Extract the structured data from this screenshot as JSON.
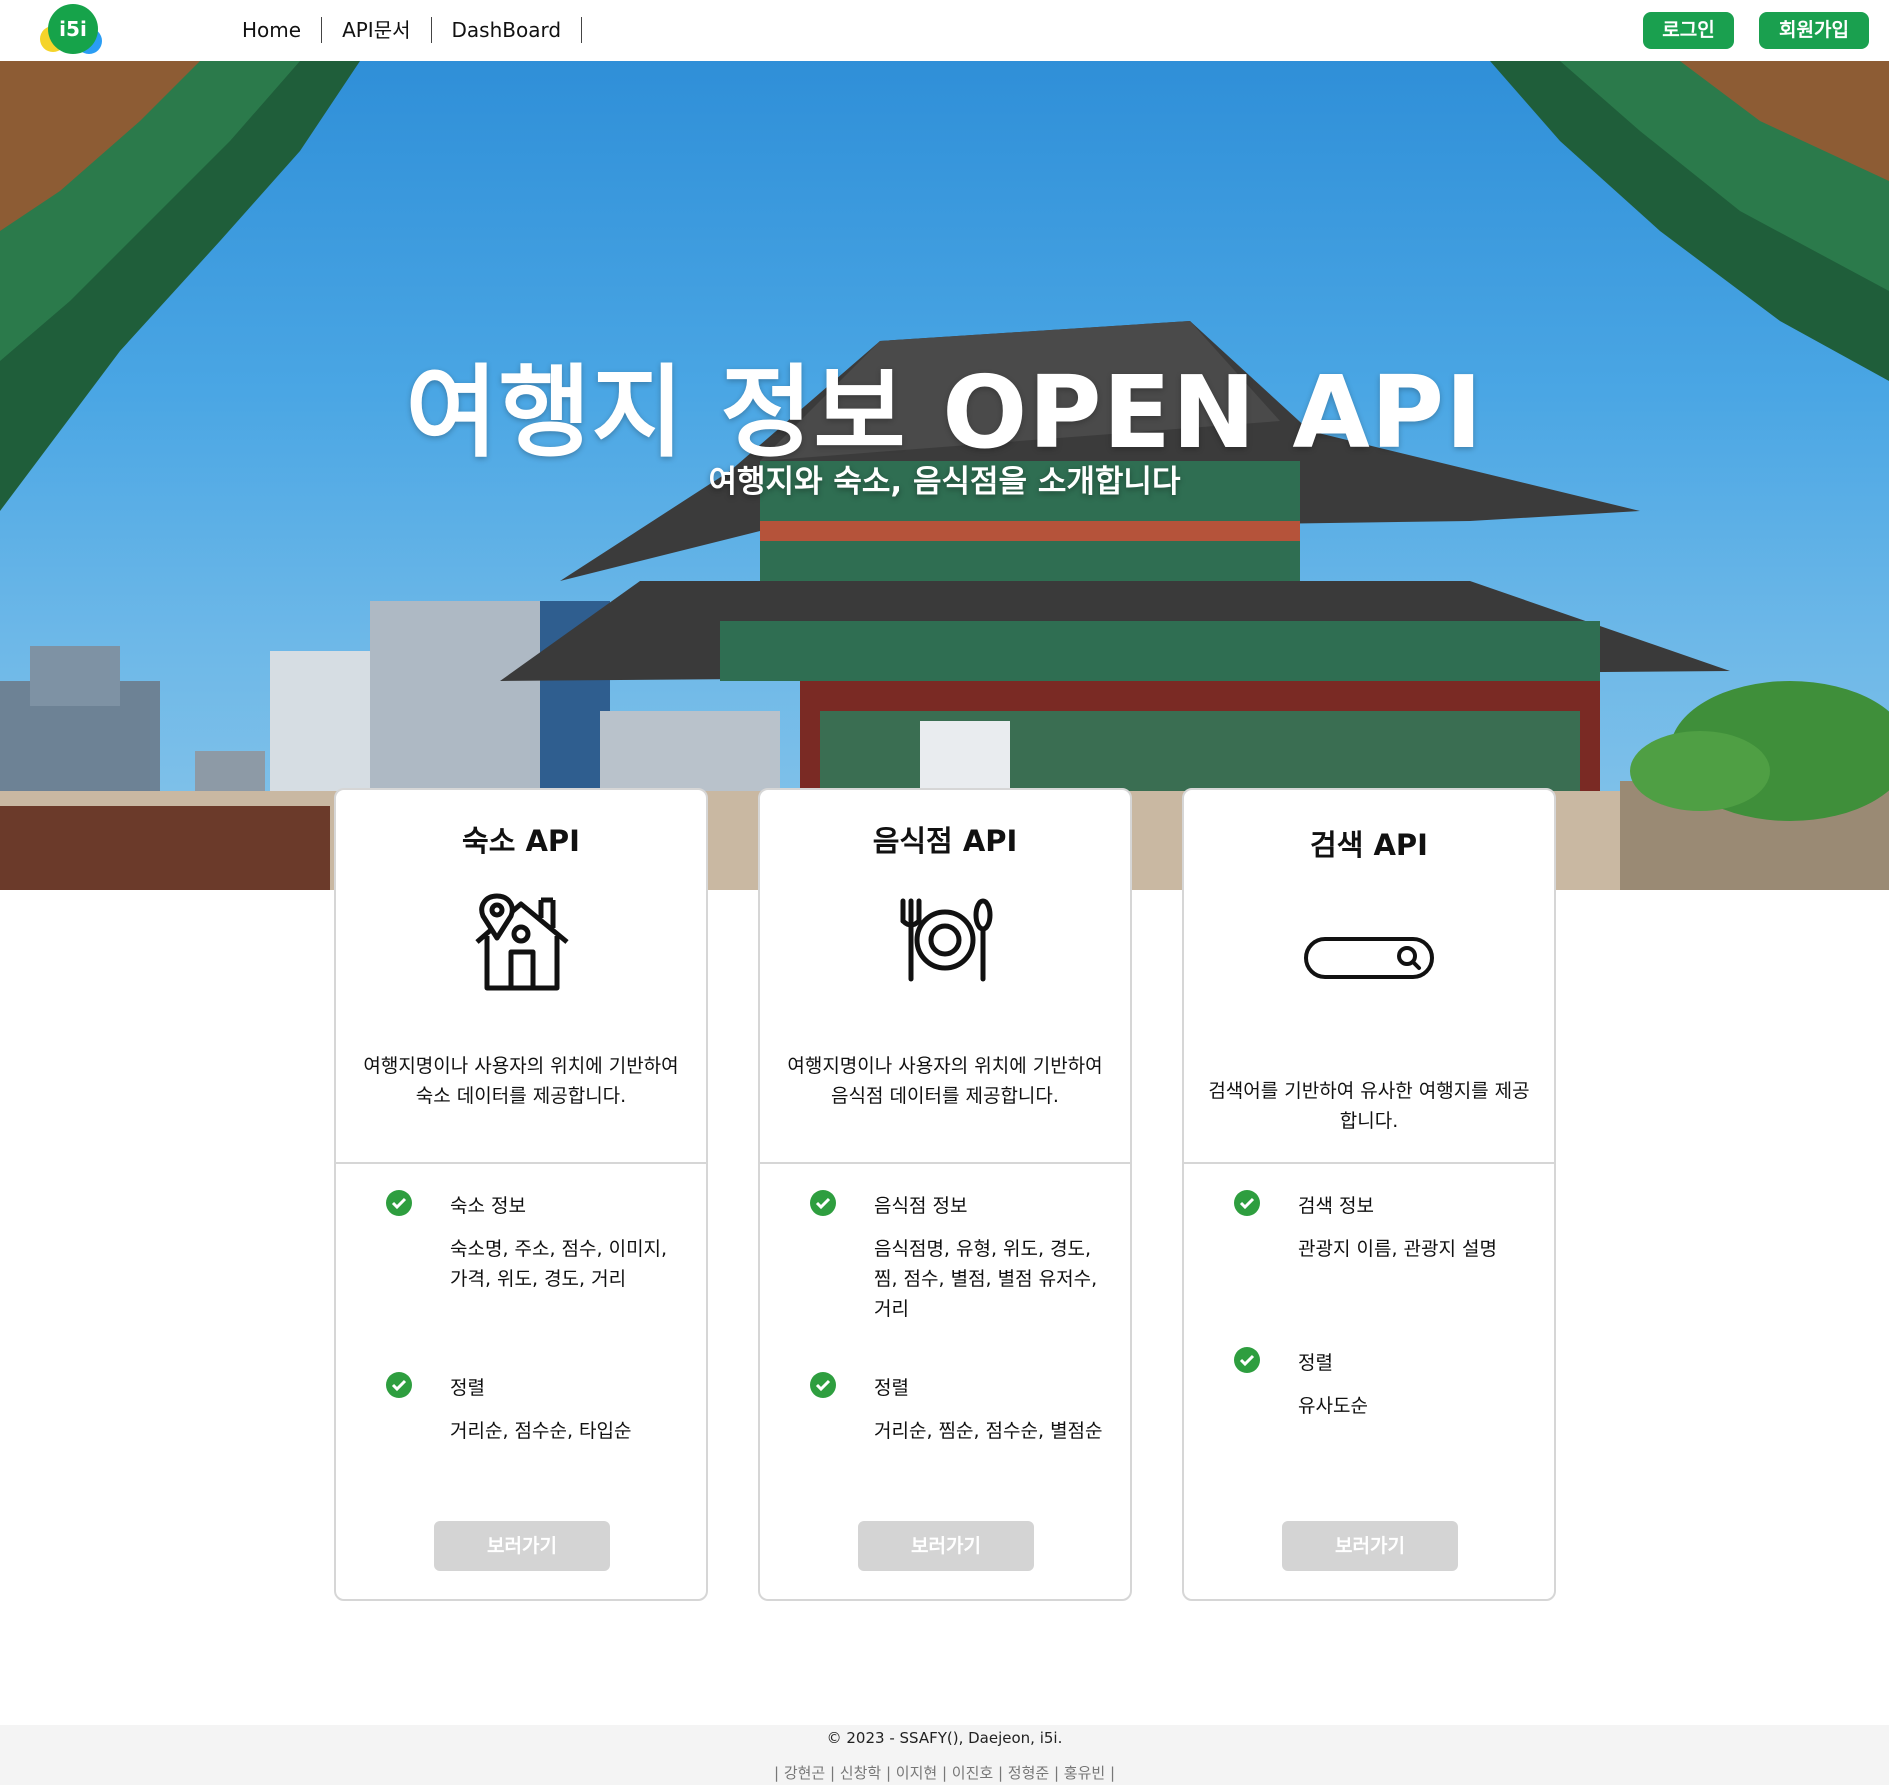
{
  "nav": {
    "logo_text": "i5i",
    "links": [
      "Home",
      "API문서",
      "DashBoard"
    ],
    "login": "로그인",
    "signup": "회원가입"
  },
  "hero": {
    "title": "여행지 정보 OPEN API",
    "subtitle": "여행지와 숙소, 음식점을 소개합니다"
  },
  "cards": [
    {
      "title": "숙소 API",
      "icon": "house-location-icon",
      "description": "여행지명이나 사용자의 위치에 기반하여 숙소 데이터를 제공합니다.",
      "features": [
        {
          "title": "숙소 정보",
          "body": "숙소명, 주소, 점수, 이미지, 가격, 위도, 경도, 거리"
        },
        {
          "title": "정렬",
          "body": "거리순, 점수순, 타입순"
        }
      ],
      "button": "보러가기"
    },
    {
      "title": "음식점 API",
      "icon": "plate-fork-spoon-icon",
      "description": "여행지명이나 사용자의 위치에 기반하여 음식점 데이터를 제공합니다.",
      "features": [
        {
          "title": "음식점 정보",
          "body": "음식점명, 유형, 위도, 경도, 찜, 점수, 별점, 별점 유저수, 거리"
        },
        {
          "title": "정렬",
          "body": "거리순, 찜순, 점수순, 별점순"
        }
      ],
      "button": "보러가기"
    },
    {
      "title": "검색 API",
      "icon": "search-bar-icon",
      "description": "검색어를 기반하여 유사한 여행지를 제공합니다.",
      "features": [
        {
          "title": "검색 정보",
          "body": "관광지 이름, 관광지 설명"
        },
        {
          "title": "정렬",
          "body": "유사도순"
        }
      ],
      "button": "보러가기"
    }
  ],
  "footer": {
    "copyright": "© 2023 - SSAFY(), Daejeon, i5i.",
    "names": "| 강현곤 | 신창학 | 이지현 | 이진호 | 정형준 | 홍유빈 |"
  },
  "colors": {
    "brand_green": "#1aa04f",
    "check_green": "#2e9e3f",
    "disabled_button": "#d4d4d4"
  }
}
